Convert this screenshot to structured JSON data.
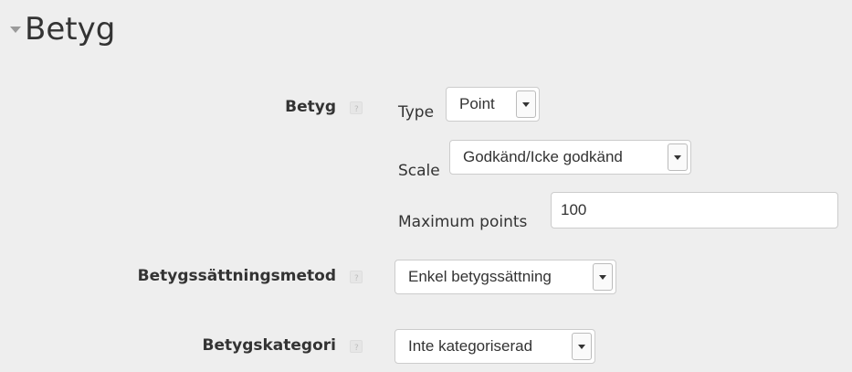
{
  "section": {
    "title": "Betyg",
    "collapse_icon": "triangle-down-icon"
  },
  "grade": {
    "label": "Betyg",
    "help_icon": "help-icon",
    "type": {
      "label": "Type",
      "value": "Point"
    },
    "scale": {
      "label": "Scale",
      "value": "Godkänd/Icke godkänd"
    },
    "max_points": {
      "label": "Maximum points",
      "value": "100"
    }
  },
  "grading_method": {
    "label": "Betygssättningsmetod",
    "help_icon": "help-icon",
    "value": "Enkel betygssättning"
  },
  "grade_category": {
    "label": "Betygskategori",
    "help_icon": "help-icon",
    "value": "Inte kategoriserad"
  },
  "colors": {
    "background": "#eeeeee",
    "text": "#333333",
    "border": "#cccccc"
  }
}
